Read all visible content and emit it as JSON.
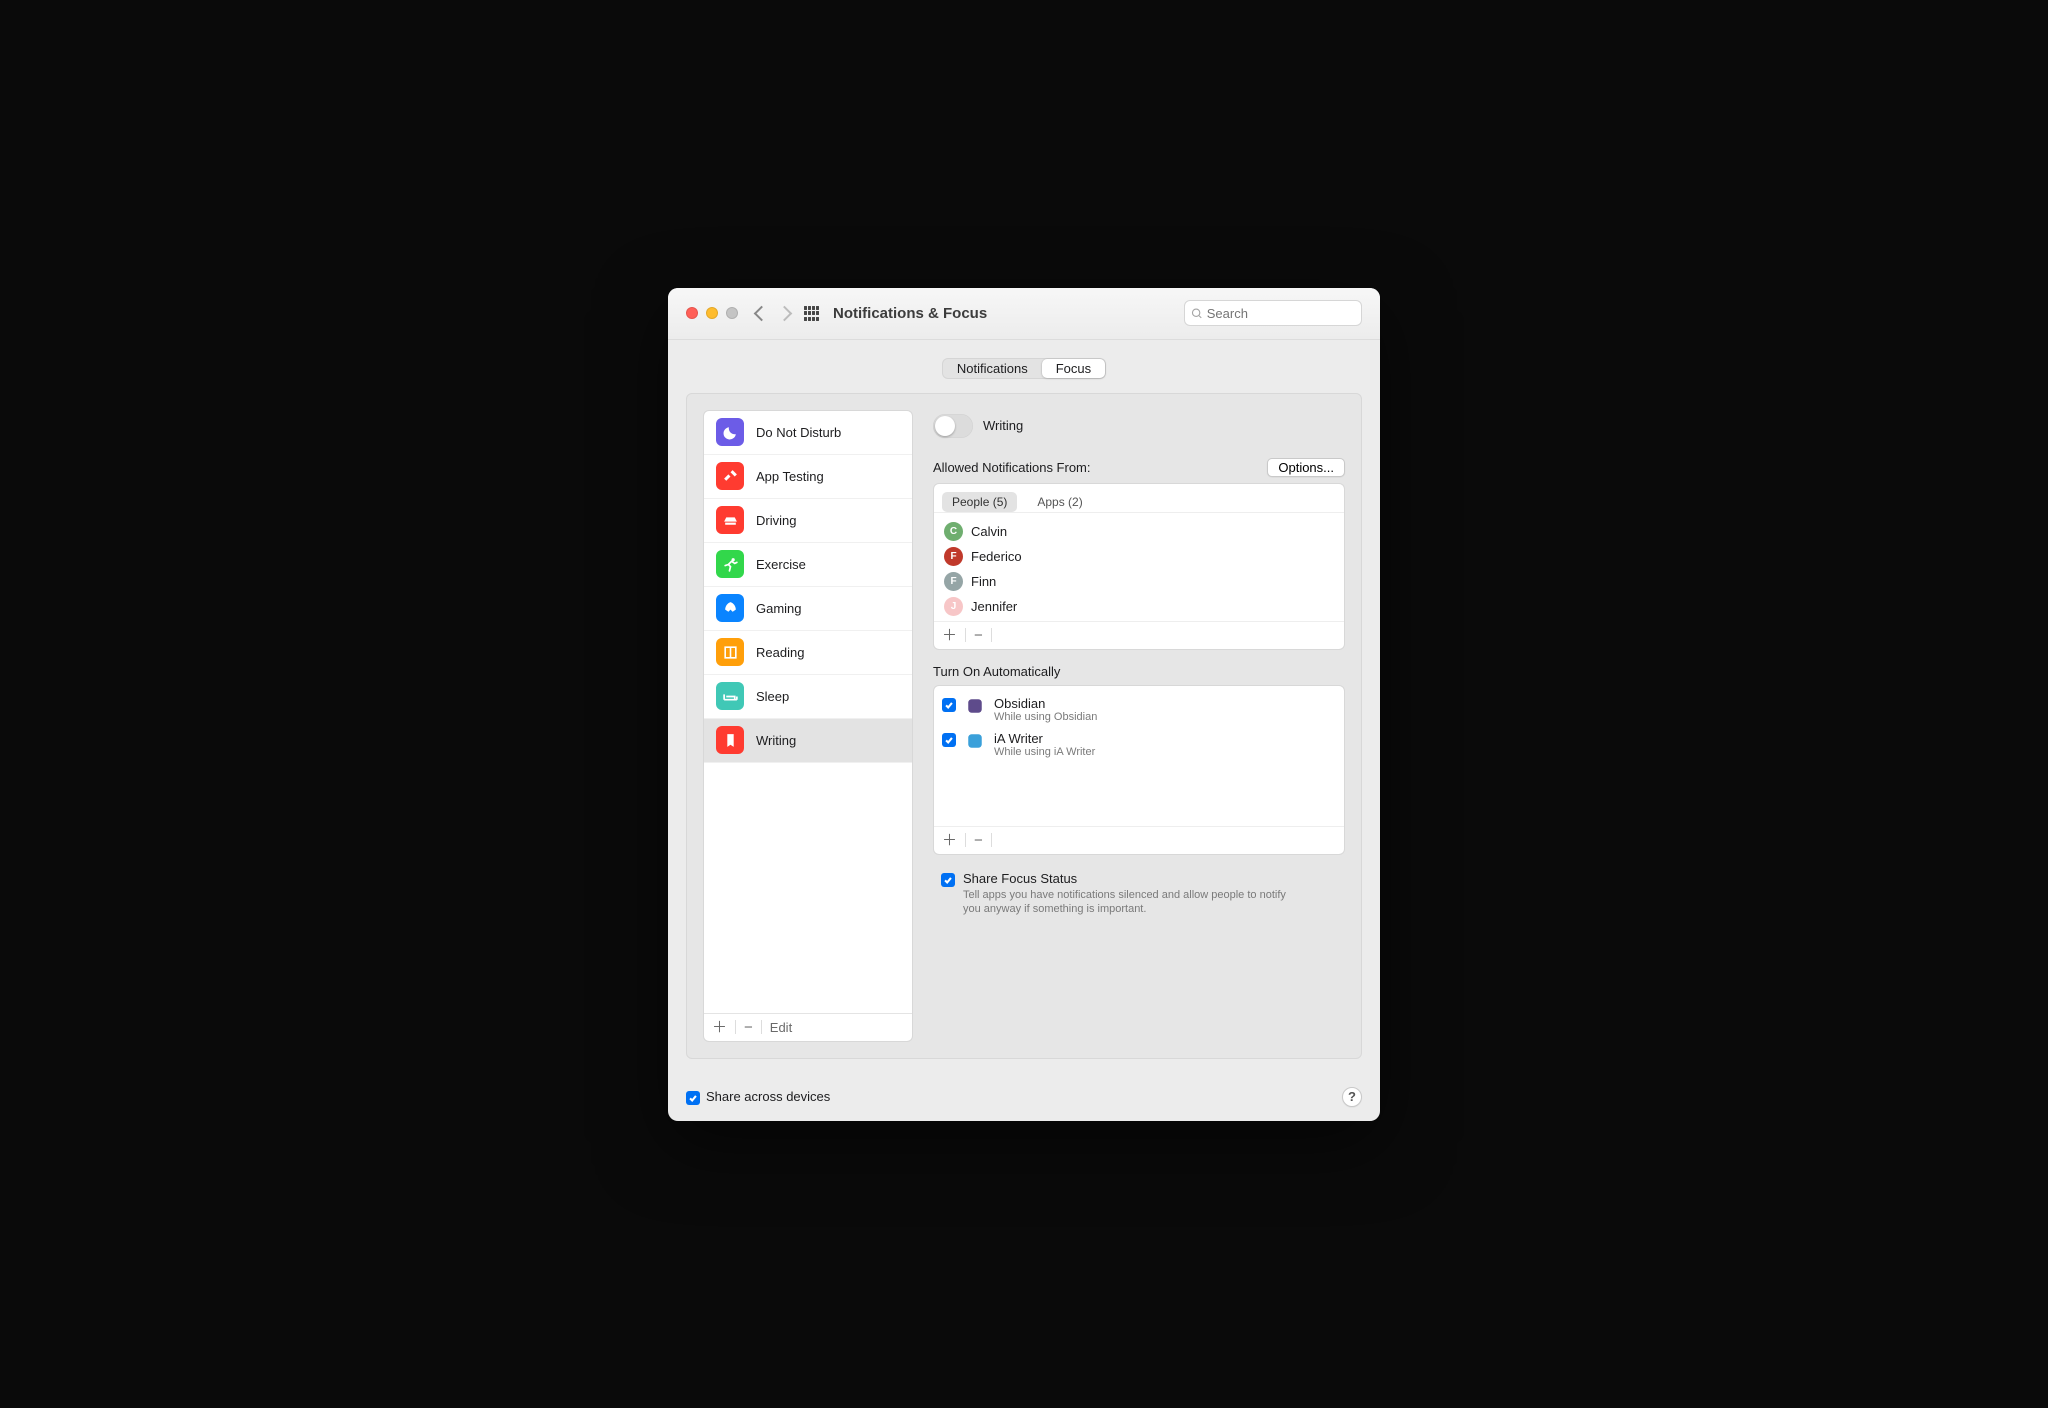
{
  "window": {
    "title": "Notifications & Focus",
    "search_placeholder": "Search"
  },
  "tabs": {
    "notifications": "Notifications",
    "focus": "Focus"
  },
  "focus_modes": [
    {
      "label": "Do Not Disturb",
      "color": "#6c5ce7",
      "icon": "moon"
    },
    {
      "label": "App Testing",
      "color": "#ff3b30",
      "icon": "tools"
    },
    {
      "label": "Driving",
      "color": "#ff3b30",
      "icon": "car"
    },
    {
      "label": "Exercise",
      "color": "#32d74b",
      "icon": "runner"
    },
    {
      "label": "Gaming",
      "color": "#0a84ff",
      "icon": "rocket"
    },
    {
      "label": "Reading",
      "color": "#ff9f0a",
      "icon": "book"
    },
    {
      "label": "Sleep",
      "color": "#40c8b6",
      "icon": "bed"
    },
    {
      "label": "Writing",
      "color": "#ff3b30",
      "icon": "bookmark",
      "selected": true
    }
  ],
  "sidebar_footer": {
    "edit": "Edit"
  },
  "detail": {
    "name": "Writing",
    "allowed_header": "Allowed Notifications From:",
    "options_btn": "Options...",
    "people_tab": "People (5)",
    "apps_tab": "Apps (2)",
    "people": [
      {
        "name": "Calvin",
        "color": "#6fae6f"
      },
      {
        "name": "Federico",
        "color": "#c0392b"
      },
      {
        "name": "Finn",
        "color": "#95a5a6"
      },
      {
        "name": "Jennifer",
        "color": "#f7c6c7"
      }
    ],
    "auto_header": "Turn On Automatically",
    "auto_items": [
      {
        "title": "Obsidian",
        "subtitle": "While using Obsidian",
        "color": "#5e4b8b"
      },
      {
        "title": "iA Writer",
        "subtitle": "While using iA Writer",
        "color": "#3aa0da"
      }
    ],
    "share_status": {
      "title": "Share Focus Status",
      "desc": "Tell apps you have notifications silenced and allow people to notify you anyway if something is important."
    }
  },
  "bottom": {
    "share_devices": "Share across devices",
    "help": "?"
  }
}
